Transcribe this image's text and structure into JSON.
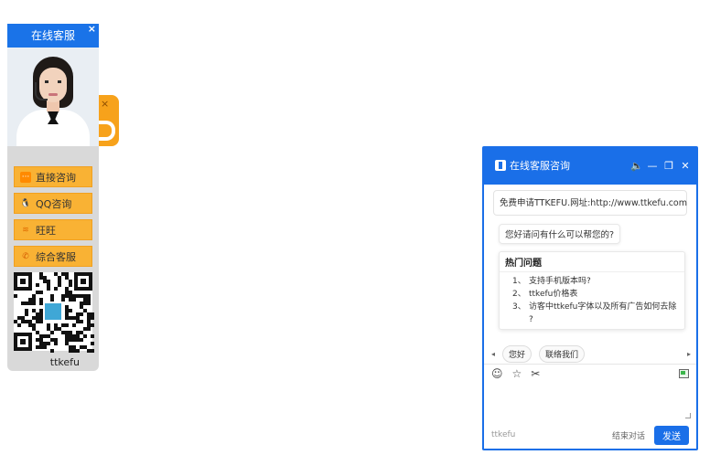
{
  "left_panel": {
    "title": "在线客服",
    "close_glyph": "×",
    "buttons": [
      {
        "label": "直接咨询",
        "icon": "chat-bubble-icon"
      },
      {
        "label": "QQ咨询",
        "icon": "qq-penguin-icon"
      },
      {
        "label": "旺旺",
        "icon": "wangwang-icon"
      },
      {
        "label": "综合客服",
        "icon": "phone-icon"
      }
    ],
    "brand": "ttkefu",
    "accent_color": "#1a73e8",
    "button_color": "#f9b234"
  },
  "float_tab": {
    "close_glyph": "×",
    "color": "#f7a21b"
  },
  "chat": {
    "title": "在线客服咨询",
    "notice": "免费申请TTKEFU.网址:http://www.ttkefu.com",
    "greeting": "您好请问有什么可以帮您的?",
    "hot_questions": {
      "title": "热门问题",
      "items": [
        {
          "num": "1、",
          "text": "支持手机版本吗?"
        },
        {
          "num": "2、",
          "text": "ttkefu价格表"
        },
        {
          "num": "3、",
          "text": "访客中ttkefu字体以及所有广告如何去除"
        },
        {
          "num": "",
          "text": "?"
        }
      ]
    },
    "quick_replies": [
      "您好",
      "联络我们"
    ],
    "toolbar_icons": [
      "emoji-icon",
      "star-icon",
      "scissors-icon",
      "image-icon"
    ],
    "footer": {
      "brand": "ttkefu",
      "end_label": "结束对话",
      "send_label": "发送"
    },
    "accent_color": "#1a6fe8"
  }
}
